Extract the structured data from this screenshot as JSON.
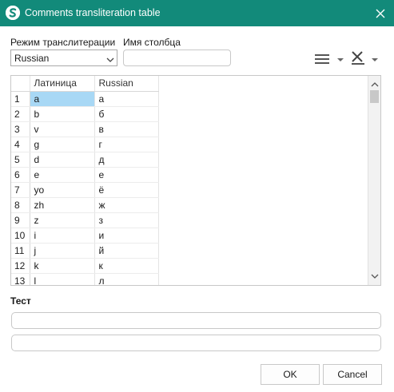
{
  "window": {
    "title": "Comments transliteration table",
    "app_icon": "logo-s-icon",
    "close_icon": "close-icon"
  },
  "form": {
    "mode_label": "Режим транслитерации",
    "mode_value": "Russian",
    "column_label": "Имя столбца",
    "column_value": ""
  },
  "toolbar": {
    "rows_icon": "rows-icon",
    "clear_icon": "clear-x-icon"
  },
  "table": {
    "headers": [
      "Латиница",
      "Russian"
    ],
    "rows": [
      {
        "n": "1",
        "latin": "a",
        "ru": "а"
      },
      {
        "n": "2",
        "latin": "b",
        "ru": "б"
      },
      {
        "n": "3",
        "latin": "v",
        "ru": "в"
      },
      {
        "n": "4",
        "latin": "g",
        "ru": "г"
      },
      {
        "n": "5",
        "latin": "d",
        "ru": "д"
      },
      {
        "n": "6",
        "latin": "e",
        "ru": "е"
      },
      {
        "n": "7",
        "latin": "yo",
        "ru": "ё"
      },
      {
        "n": "8",
        "latin": "zh",
        "ru": "ж"
      },
      {
        "n": "9",
        "latin": "z",
        "ru": "з"
      },
      {
        "n": "10",
        "latin": "i",
        "ru": "и"
      },
      {
        "n": "11",
        "latin": "j",
        "ru": "й"
      },
      {
        "n": "12",
        "latin": "k",
        "ru": "к"
      },
      {
        "n": "13",
        "latin": "l",
        "ru": "л"
      }
    ]
  },
  "test": {
    "label": "Тест",
    "input_value": "",
    "output_value": ""
  },
  "buttons": {
    "ok": "OK",
    "cancel": "Cancel"
  },
  "colors": {
    "titlebar": "#128a7a",
    "selection": "#a8d8f5"
  }
}
